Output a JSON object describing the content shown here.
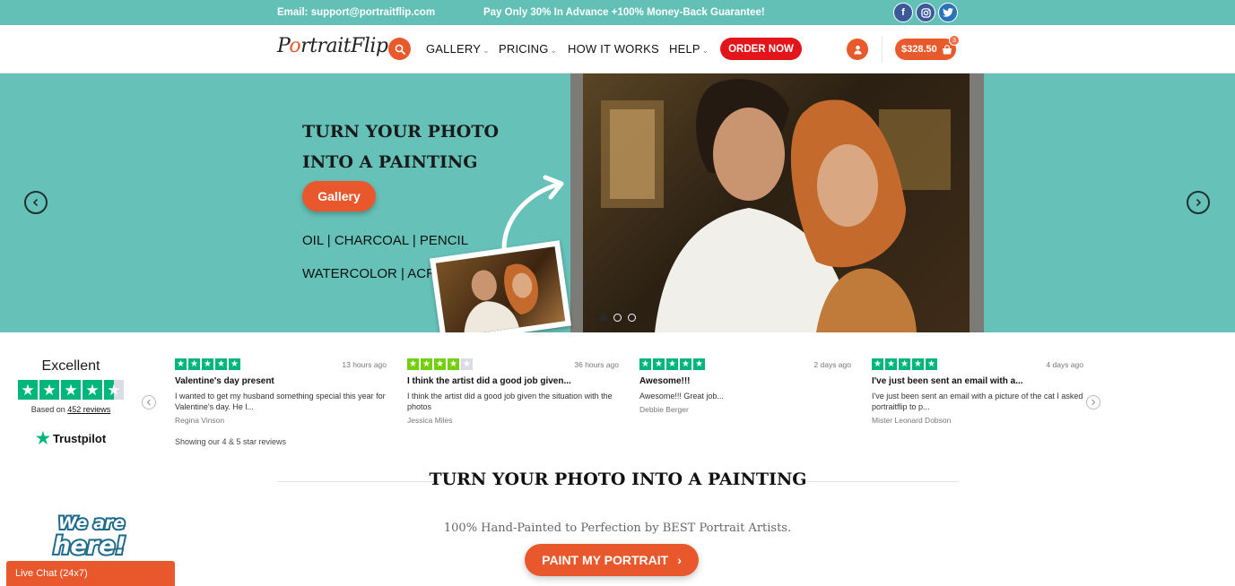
{
  "topbar": {
    "email": "Email: support@portraitflip.com",
    "promo": "Pay Only 30% In Advance +100% Money-Back Guarantee!",
    "social": [
      {
        "icon": "facebook-icon",
        "glyph": "f"
      },
      {
        "icon": "instagram-icon",
        "glyph": "◎"
      },
      {
        "icon": "twitter-icon",
        "glyph": "🐦"
      }
    ],
    "color": "#62c0b6"
  },
  "nav": {
    "logo": {
      "text_a": "P",
      "dot": "o",
      "text_b": "rtrait",
      "text_c": "Flip"
    },
    "items": [
      {
        "label": "GALLERY",
        "has_dropdown": true
      },
      {
        "label": "PRICING",
        "has_dropdown": true
      },
      {
        "label": "HOW IT WORKS",
        "has_dropdown": false
      },
      {
        "label": "HELP",
        "has_dropdown": true
      }
    ],
    "chevron": "⌄",
    "order_label": "ORDER NOW",
    "cart_total": "$328.50",
    "cart_count": "3",
    "accent": "#e8582c",
    "order_color": "#e3151b"
  },
  "hero": {
    "title_line1": "TURN YOUR PHOTO",
    "title_line2": "INTO A PAINTING",
    "gallery_label": "Gallery",
    "media_line1": "OIL | CHARCOAL | PENCIL",
    "media_line2": "WATERCOLOR | ACRYLIC",
    "slides": 3,
    "active_slide": 1,
    "bg_color": "#66c1b8"
  },
  "trustpilot": {
    "rating_word": "Excellent",
    "based_prefix": "Based on",
    "review_count": "452 reviews",
    "brand": "Trustpilot",
    "showing": "Showing our 4 & 5 star reviews",
    "reviews": [
      {
        "stars": 5,
        "time": "13 hours ago",
        "title": "Valentine's day present",
        "body": "I wanted to get my husband something special this year for Valentine's day. He l...",
        "author": "Regina Vinson"
      },
      {
        "stars": 4,
        "time": "36 hours ago",
        "title": "I think the artist did a good job given...",
        "body": "I think the artist did a good job given the situation with the photos",
        "author": "Jessica Miles"
      },
      {
        "stars": 5,
        "time": "2 days ago",
        "title": "Awesome!!!",
        "body": "Awesome!!! Great job...",
        "author": "Debbie Berger"
      },
      {
        "stars": 5,
        "time": "4 days ago",
        "title": "I've just been sent an email with a...",
        "body": "I've just been sent an email with a picture of the cat I asked portraitflip to p...",
        "author": "Mister Leonard Dobson"
      }
    ]
  },
  "section": {
    "title": "TURN YOUR PHOTO INTO A PAINTING",
    "subtitle": "100% Hand-Painted to Perfection by BEST Portrait Artists.",
    "cta": "PAINT MY PORTRAIT",
    "cta_arrow": "›"
  },
  "chat": {
    "badge_line1": "We are",
    "badge_line2": "here!",
    "label": "Live Chat (24x7)"
  }
}
